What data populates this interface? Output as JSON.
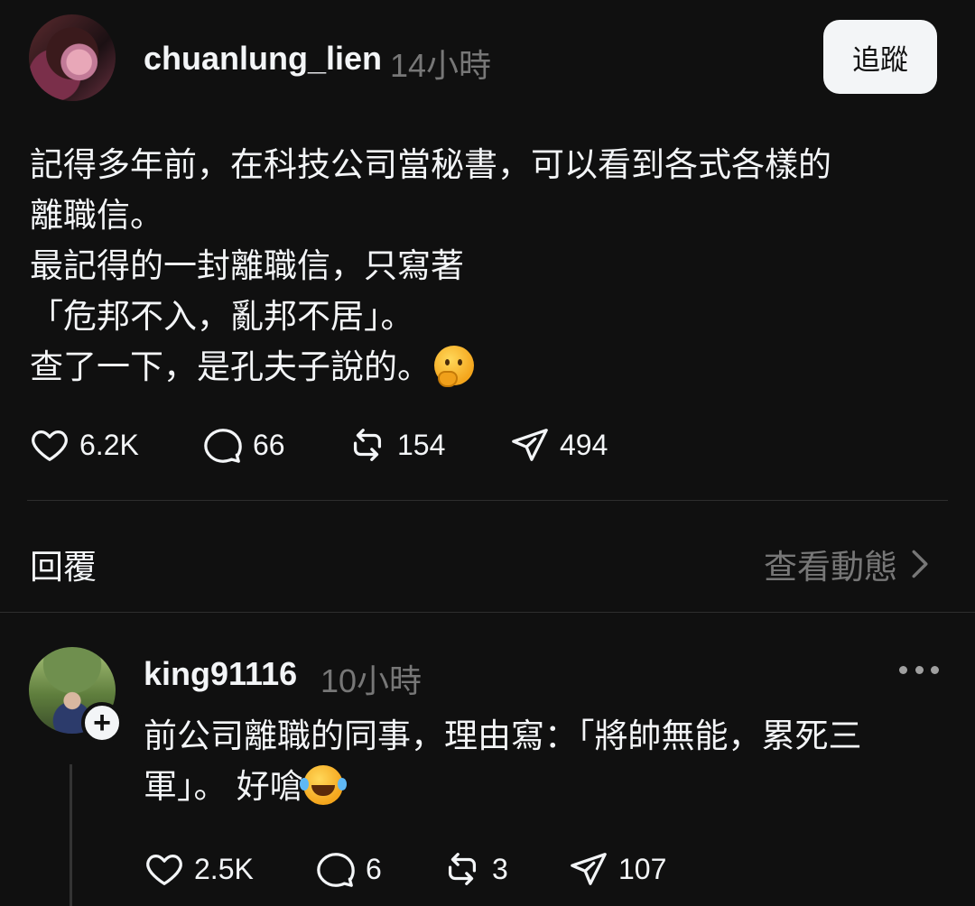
{
  "post": {
    "username": "chuanlung_lien",
    "time": "14小時",
    "follow_label": "追蹤",
    "text_lines": [
      "記得多年前，在科技公司當秘書，可以看到各式各樣的",
      "離職信。",
      "最記得的一封離職信，只寫著",
      "「危邦不入，亂邦不居」。",
      "查了一下，是孔夫子說的。"
    ],
    "emoji": "thinking-face-emoji",
    "likes": "6.2K",
    "comments": "66",
    "reposts": "154",
    "shares": "494"
  },
  "replies_section": {
    "title": "回覆",
    "view_activity_label": "查看動態"
  },
  "reply": {
    "username": "king91116",
    "time": "10小時",
    "text_lines": [
      "前公司離職的同事，理由寫：「將帥無能，累死三",
      "軍」。 好嗆"
    ],
    "emoji": "laughing-tears-emoji",
    "likes": "2.5K",
    "comments": "6",
    "reposts": "3",
    "shares": "107"
  },
  "colors": {
    "background": "#101010",
    "text": "#f3f5f7",
    "muted": "#777777",
    "divider": "#2e2e2e"
  }
}
